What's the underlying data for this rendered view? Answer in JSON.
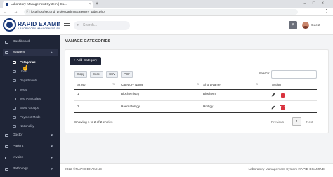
{
  "browser": {
    "tab_title": "Laboratory Management System | Ca...",
    "url": "localhost/second_project/admin/category_table.php",
    "nav_glyphs": "← → ⟳",
    "menu_glyph": "⋮",
    "window_buttons": "–□×"
  },
  "brand": {
    "name": "RAPID EXAMINE",
    "subtitle": "LABORATORY MANAGEMENT SYSTEM"
  },
  "sidebar": {
    "items": [
      {
        "label": "Dashboard",
        "icon": "dashboard-icon"
      },
      {
        "label": "Masters",
        "icon": "masters-icon",
        "chevron": "▲"
      },
      {
        "label": "Doctor",
        "icon": "doctor-icon",
        "chevron": "▼"
      },
      {
        "label": "Patient",
        "icon": "patient-icon",
        "chevron": "▼"
      },
      {
        "label": "Invoice",
        "icon": "invoice-icon",
        "chevron": "▼"
      },
      {
        "label": "Pathology",
        "icon": "pathology-icon",
        "chevron": "▼"
      }
    ],
    "sub_items": [
      {
        "label": "Categories",
        "active": true
      },
      {
        "label": "Units"
      },
      {
        "label": "Departments"
      },
      {
        "label": "Tests"
      },
      {
        "label": "Test Particulars"
      },
      {
        "label": "Blood Groups"
      },
      {
        "label": "Payment Mode"
      },
      {
        "label": "Nationality"
      }
    ]
  },
  "topbar": {
    "search_placeholder": "Search...",
    "translate_glyph": "A",
    "user": "Guest"
  },
  "page": {
    "title": "MANAGE CATEGORIES",
    "add_button": "+ Add Category",
    "export_buttons": [
      "Copy",
      "Excel",
      "CSV",
      "PDF"
    ],
    "search_label": "Search:",
    "columns": [
      "Sr.No",
      "Category Name",
      "Short Name",
      "Action"
    ],
    "rows": [
      {
        "sr": "1",
        "name": "Biochemistry",
        "short": "Biochem"
      },
      {
        "sr": "2",
        "name": "Haematology",
        "short": "Hmtlgy"
      }
    ],
    "showing": "Showing 1 to 2 of 2 entries",
    "pagination": {
      "prev": "Previous",
      "current": "1",
      "next": "Next"
    }
  },
  "footer": {
    "left": "2022 ©RAPID EXAMINE",
    "right": "Laboratory Management System RAPID EXAMINE"
  },
  "colors": {
    "sidebar": "#1f2537",
    "brand": "#1b3a7a",
    "delete": "#d9333f",
    "edit": "#333333"
  }
}
